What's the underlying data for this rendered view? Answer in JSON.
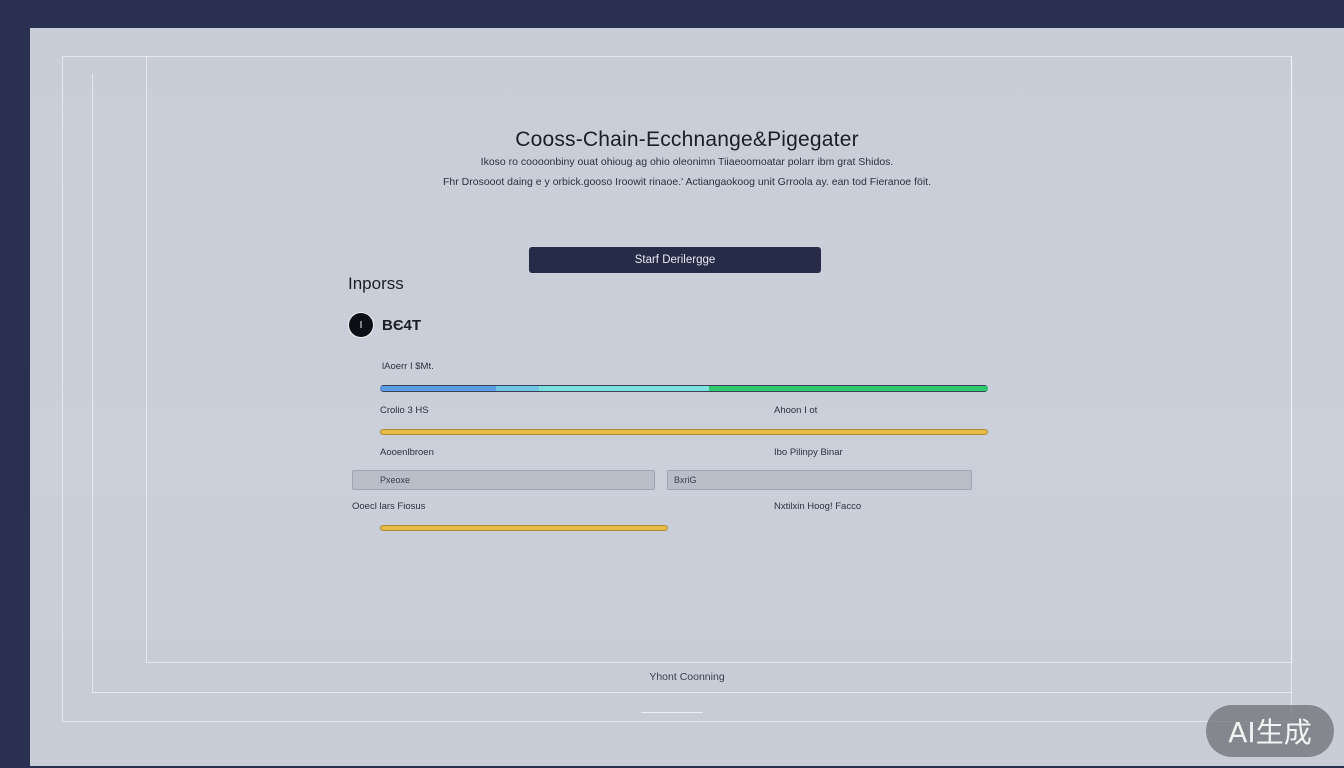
{
  "header": {
    "title": "Cooss-Chain-Ecchnange&Pigegater",
    "description_line1": "Ikoso ro coooonbiny ouat ohioug ag ohio oleonimn Tiiaeoomoatar polarr ibm grat Shidos.",
    "description_line2": "Fhr Drosooot daing e y orbick.gooso Iroowit rinaoe.' Actiangaokoog unit Grroola ay. ean tod Fieranoe föit."
  },
  "actions": {
    "start_label": "Starf Derilergge"
  },
  "section": {
    "title": "Inporss"
  },
  "token": {
    "icon_glyph": "I",
    "icon_name": "token-coin-icon",
    "symbol": "BЄ4T"
  },
  "progress": {
    "label": "lAoerr I $Mt.",
    "segments": [
      {
        "color": "#5b9be4",
        "fraction": 0.19
      },
      {
        "color": "#72c6e4",
        "fraction": 0.07
      },
      {
        "color": "#7ce0dc",
        "fraction": 0.28
      },
      {
        "color": "#2ec86e",
        "fraction": 0.46
      }
    ]
  },
  "row1": {
    "left_label": "Crolio 3 HS",
    "right_label": "Ahoon I ot",
    "bar_fraction": 1.0,
    "bar_color": "#e8bc48"
  },
  "row2": {
    "left_label": "Aooenlbroen",
    "right_label": "Ibo Pilinpy Binar",
    "left_field_value": "Pxeoxe",
    "right_field_value": "BxriG"
  },
  "row3": {
    "left_label": "Ooecl lars Fiosus",
    "right_label": "Nxtilxin Hoog! Facco",
    "bar_fraction": 0.47,
    "bar_color": "#e8bc48"
  },
  "footer": {
    "text": "Yhont Coonning"
  },
  "watermark": {
    "text": "AI生成"
  }
}
